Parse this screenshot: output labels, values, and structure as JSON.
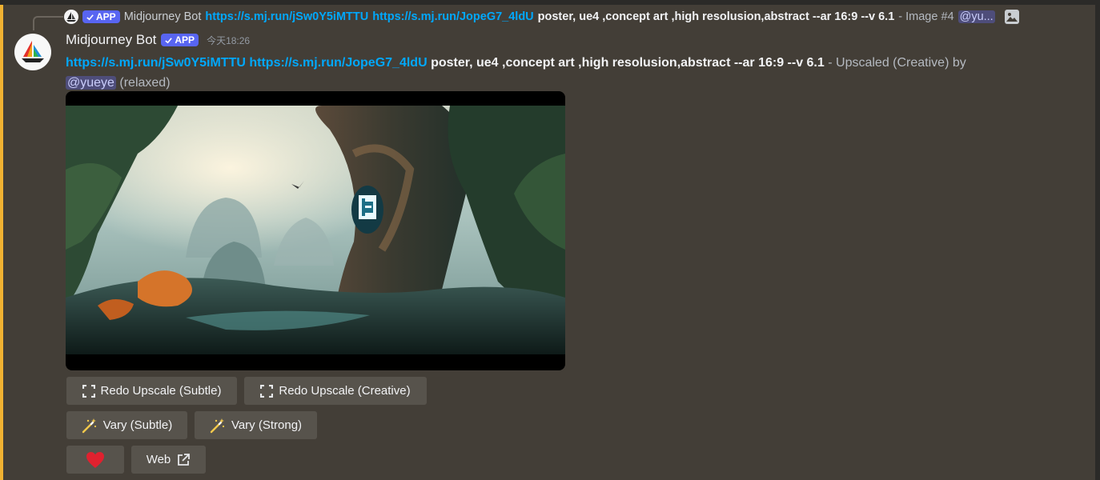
{
  "reply": {
    "author": "Midjourney Bot",
    "badge": "APP",
    "link1": "https://s.mj.run/jSw0Y5iMTTU",
    "link2": "https://s.mj.run/JopeG7_4ldU",
    "prompt": "poster, ue4 ,concept art ,high resolusion,abstract --ar 16:9 --v 6.1",
    "suffix": "- Image #4",
    "mention": "@yu..."
  },
  "message": {
    "author": "Midjourney Bot",
    "badge": "APP",
    "timestamp": "今天18:26",
    "link1": "https://s.mj.run/jSw0Y5iMTTU",
    "link2": "https://s.mj.run/JopeG7_4ldU",
    "prompt": "poster, ue4 ,concept art ,high resolusion,abstract --ar 16:9 --v 6.1",
    "status": "- Upscaled (Creative) by",
    "mention": "@yueye",
    "mode": "(relaxed)"
  },
  "buttons": {
    "redo_subtle": "Redo Upscale (Subtle)",
    "redo_creative": "Redo Upscale (Creative)",
    "vary_subtle": "Vary (Subtle)",
    "vary_strong": "Vary (Strong)",
    "web": "Web"
  },
  "icons": {
    "upscale": "expand-corners-icon",
    "vary": "magic-wand-icon",
    "favorite": "heart-icon",
    "external": "external-link-icon",
    "image": "image-icon",
    "check": "check-icon"
  },
  "colors": {
    "accent": "#f0b232",
    "link": "#00a8fc",
    "badge": "#5865f2",
    "heart": "#e0212f",
    "background": "#433e37"
  }
}
